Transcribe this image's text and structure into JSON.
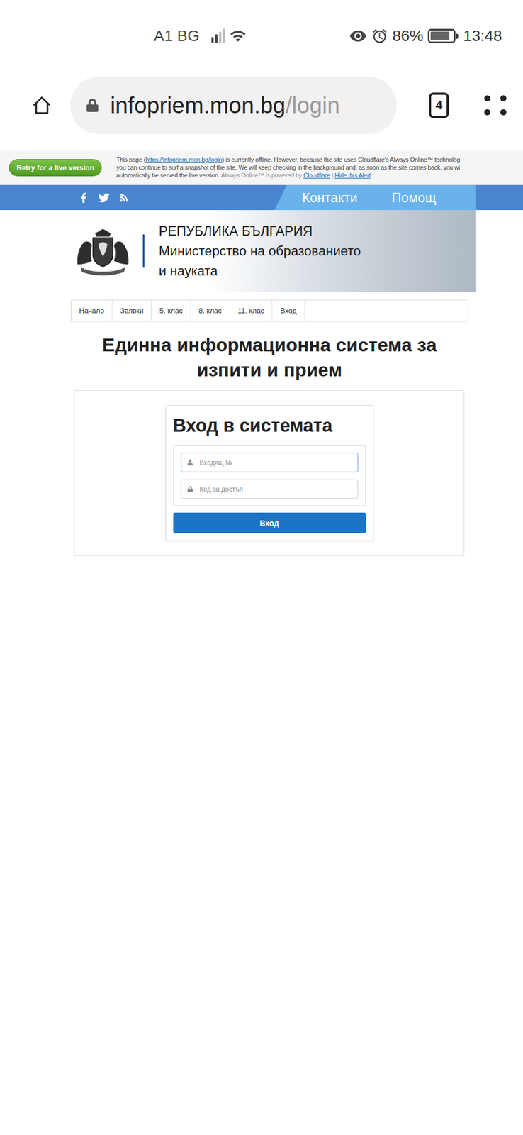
{
  "status_bar": {
    "carrier": "A1 BG",
    "signal_level": 0.5,
    "battery": "86%",
    "battery_level": 0.86,
    "time": "13:48"
  },
  "browser": {
    "url_host": "infopriem.mon.bg",
    "url_path": "/login",
    "tab_count": "4"
  },
  "alert": {
    "button": "Retry for a live version",
    "lines": [
      [
        {
          "text": "This page (",
          "style": "plain"
        },
        {
          "text": "https://infopriem.mon.bg/login",
          "style": "link"
        },
        {
          "text": ") is currently offline. However, because the site uses Cloudflare's Always Online™ technolog",
          "style": "plain"
        }
      ],
      [
        {
          "text": "you can continue to surf a snapshot of the site. We will keep checking in the background and, as soon as the site comes back, you wi",
          "style": "plain"
        }
      ],
      [
        {
          "text": "automatically be served the live version. ",
          "style": "plain"
        },
        {
          "text": "Always Online™ is powered by ",
          "style": "muted"
        },
        {
          "text": "Cloudflare",
          "style": "link"
        },
        {
          "text": " | ",
          "style": "muted"
        },
        {
          "text": "Hide this Alert",
          "style": "link"
        }
      ]
    ]
  },
  "site_nav": {
    "links": [
      "Контакти",
      "Помощ"
    ]
  },
  "site_header": {
    "country": "РЕПУБЛИКА БЪЛГАРИЯ",
    "ministry_lines": [
      "Министерство на образованието",
      "и науката"
    ]
  },
  "menu": [
    {
      "label": "Начало",
      "selected": false
    },
    {
      "label": "Заявки",
      "selected": false
    },
    {
      "label": "5. клас",
      "selected": false
    },
    {
      "label": "8. клас",
      "selected": false
    },
    {
      "label": "11. клас",
      "selected": false
    },
    {
      "label": "Вход",
      "selected": false
    }
  ],
  "page_title_lines": [
    "Единна информационна система за",
    "изпити и прием"
  ],
  "login": {
    "title": "Вход в системата",
    "fields": [
      {
        "placeholder": "Входящ №",
        "kind": "user",
        "focused": true
      },
      {
        "placeholder": "Код за достъп",
        "kind": "password",
        "focused": false
      }
    ],
    "button": "Вход"
  }
}
